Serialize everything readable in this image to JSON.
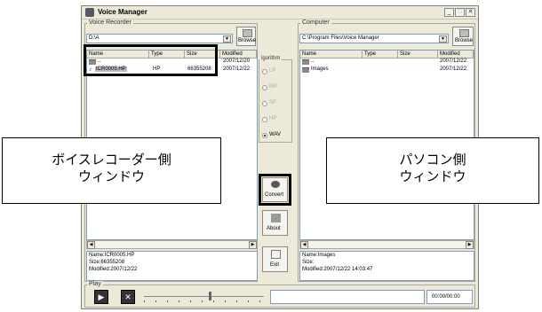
{
  "window": {
    "title": "Voice Manager"
  },
  "recorder": {
    "group_label": "Voice Recorder",
    "path": "D:\\A",
    "browse_label": "Browse",
    "columns": [
      "Name",
      "Type",
      "Size",
      "Modified"
    ],
    "rows": [
      {
        "name": "..",
        "type": "",
        "size": "",
        "modified": "2007/12/20"
      },
      {
        "name": "ICR0005.HP",
        "type": "HP",
        "size": "66355208",
        "modified": "2007/12/22"
      }
    ],
    "info_name": "Name:ICR0005.HP",
    "info_size": "Size:66355208",
    "info_modified": "Modified:2007/12/22"
  },
  "computer": {
    "group_label": "Computer",
    "path": "C:\\Program Files\\Voice Manager",
    "browse_label": "Browse",
    "columns": [
      "Name",
      "Type",
      "Size",
      "Modified"
    ],
    "rows": [
      {
        "name": "..",
        "type": "",
        "size": "",
        "modified": "2007/12/22"
      },
      {
        "name": "Images",
        "type": "",
        "size": "",
        "modified": "2007/12/22"
      }
    ],
    "info_name": "Name:Images",
    "info_size": "Size:",
    "info_modified": "Modified:2007/12/22 14:03:47"
  },
  "algorithm": {
    "label": "lgorithm",
    "options": [
      "LP",
      "MP",
      "SP",
      "HP",
      "WAV"
    ],
    "selected": "WAV"
  },
  "buttons": {
    "convert": "Convert",
    "about": "About",
    "exit": "Exit"
  },
  "play": {
    "group_label": "Play",
    "time": "00:00/00:00",
    "slider_position": 0.55
  },
  "callouts": {
    "recorder_line1": "ボイスレコーダー側",
    "recorder_line2": "ウィンドウ",
    "pc_line1": "パソコン側",
    "pc_line2": "ウィンドウ"
  }
}
